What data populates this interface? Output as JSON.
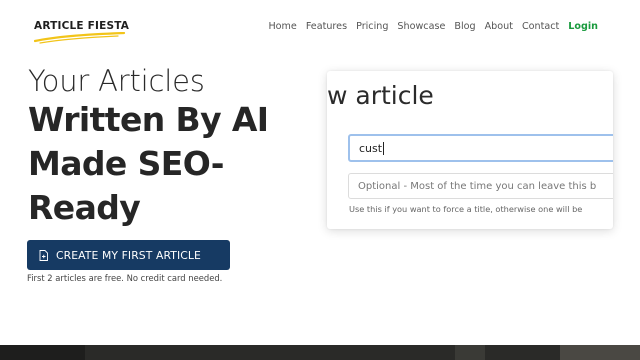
{
  "logo": {
    "text": "ARTICLE FIESTA",
    "underline_color": "#f2c419"
  },
  "nav": {
    "items": [
      "Home",
      "Features",
      "Pricing",
      "Showcase",
      "Blog",
      "About",
      "Contact"
    ],
    "login": "Login",
    "login_color": "#1a9b3e"
  },
  "hero": {
    "line1": "Your Articles",
    "line2": "Written By AI",
    "line3": "Made SEO-",
    "line4": "Ready",
    "cta_label": "CREATE MY FIRST ARTICLE",
    "cta_icon": "document-icon",
    "cta_color": "#163a63",
    "note": "First 2 articles are free. No credit card needed."
  },
  "preview": {
    "title": "w article",
    "input_value": "cust",
    "optional_placeholder": "Optional - Most of the time you can leave this b",
    "help_text": "Use this if you want to force a title, otherwise one will be"
  }
}
